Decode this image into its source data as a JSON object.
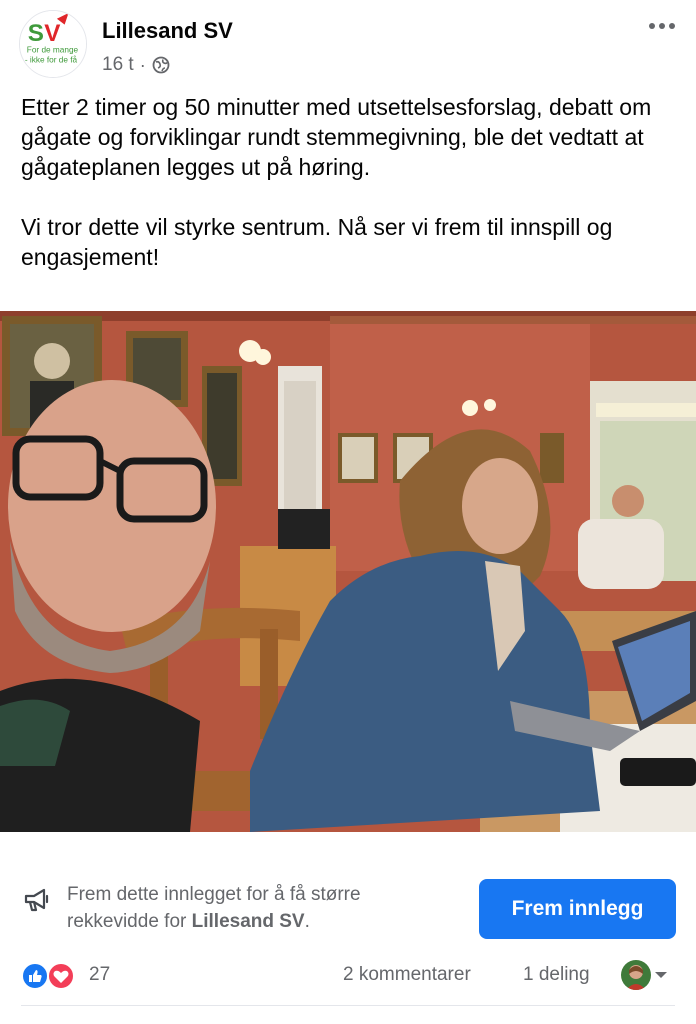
{
  "header": {
    "page_name": "Lillesand SV",
    "time": "16 t",
    "separator": "·",
    "logo": {
      "letters": "SV",
      "tagline_1": "For de mange",
      "tagline_2": "- ikke for de få"
    },
    "privacy_icon": "globe-icon",
    "more_icon": "more-dots-icon"
  },
  "post": {
    "paragraph_1": "Etter 2 timer og 50 minutter med utsettelsesforslag, debatt om gågate og forviklingar rundt stemmegivning, ble det vedtatt at gågateplanen legges ut på høring.",
    "paragraph_2": "Vi tror dette vil styrke sentrum. Nå ser vi frem til innspill og engasjement!"
  },
  "promote": {
    "text_prefix": "Frem dette innlegget for å få større rekkevidde for ",
    "page_name": "Lillesand SV",
    "text_suffix": ".",
    "button_label": "Frem innlegg",
    "icon": "megaphone-icon"
  },
  "reactions": {
    "count": "27",
    "types": [
      "like-icon",
      "love-icon"
    ],
    "comments": "2 kommentarer",
    "shares": "1 deling"
  },
  "colors": {
    "brand_blue": "#1877f2",
    "text_primary": "#050505",
    "text_secondary": "#65676b",
    "sv_red": "#e0262a",
    "sv_green": "#3f9a3b",
    "love_red": "#f33e58"
  }
}
